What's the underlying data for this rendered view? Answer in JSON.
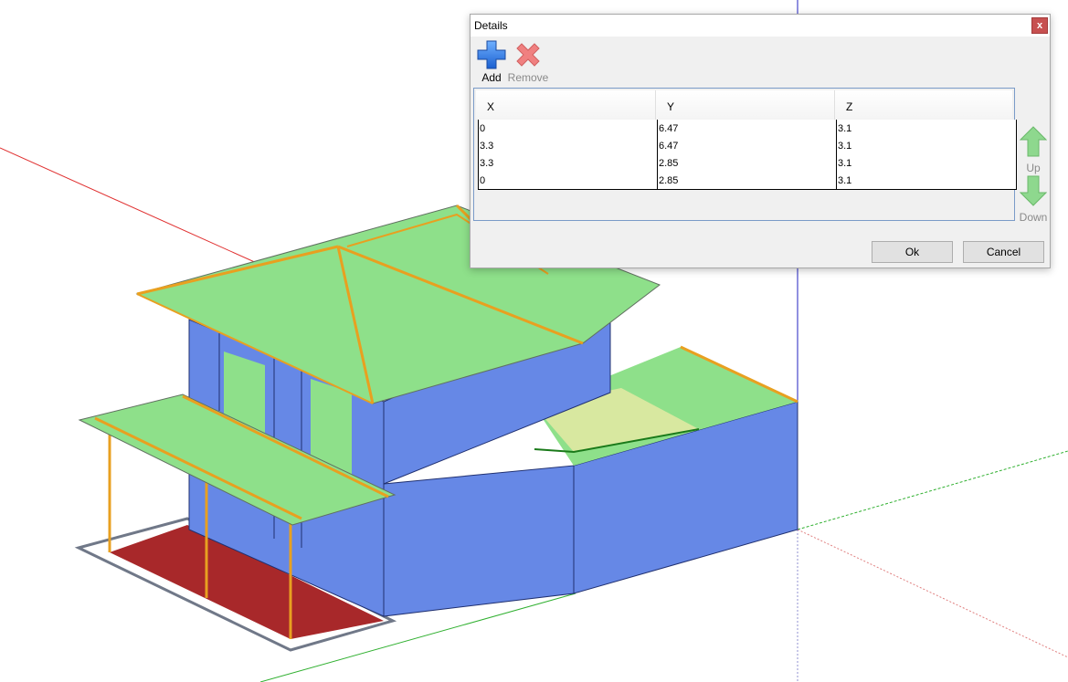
{
  "dialog": {
    "title": "Details",
    "close_glyph": "x",
    "toolbar": {
      "add_label": "Add",
      "add_icon": "plus-icon",
      "remove_label": "Remove",
      "remove_icon": "x-icon"
    },
    "table": {
      "columns": [
        "X",
        "Y",
        "Z"
      ],
      "rows": [
        [
          "0",
          "6.47",
          "3.1"
        ],
        [
          "3.3",
          "6.47",
          "3.1"
        ],
        [
          "3.3",
          "2.85",
          "3.1"
        ],
        [
          "0",
          "2.85",
          "3.1"
        ]
      ]
    },
    "up_label": "Up",
    "down_label": "Down",
    "ok_label": "Ok",
    "cancel_label": "Cancel"
  },
  "colors": {
    "roof": "#8ee08a",
    "wall": "#6688e6",
    "floor": "#a8282a",
    "beam": "#e8a020",
    "axis_red": "#e03030",
    "axis_green": "#30b030",
    "axis_blue": "#2020c0"
  }
}
